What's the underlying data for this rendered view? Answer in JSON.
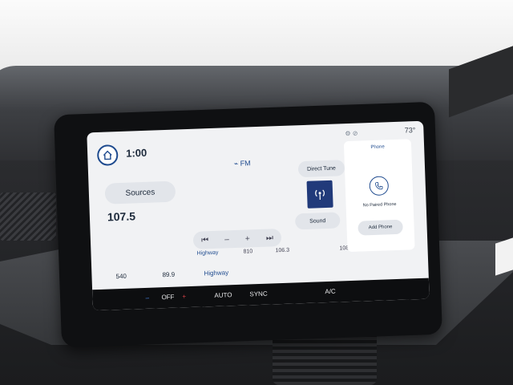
{
  "status": {
    "time": "1:00",
    "temperature": "73°"
  },
  "radio": {
    "band": "FM",
    "frequency": "107.5",
    "sources_label": "Sources",
    "direct_tune_label": "Direct Tune",
    "sound_label": "Sound",
    "minus": "–",
    "plus": "+",
    "prev": "⏮",
    "next": "⏭"
  },
  "seek_scale": [
    "810",
    "106.3",
    "108"
  ],
  "seek_station": "Highway",
  "phone": {
    "title": "Phone",
    "status": "No Paired Phone",
    "add_label": "Add Phone"
  },
  "presets": [
    "540",
    "89.9",
    "Highway"
  ],
  "climate": {
    "off_label": "OFF",
    "minus": "–",
    "plus": "+",
    "auto_label": "AUTO",
    "sync_label": "SYNC",
    "ac_label": "A/C"
  },
  "accent_color": "#1f4b8f"
}
